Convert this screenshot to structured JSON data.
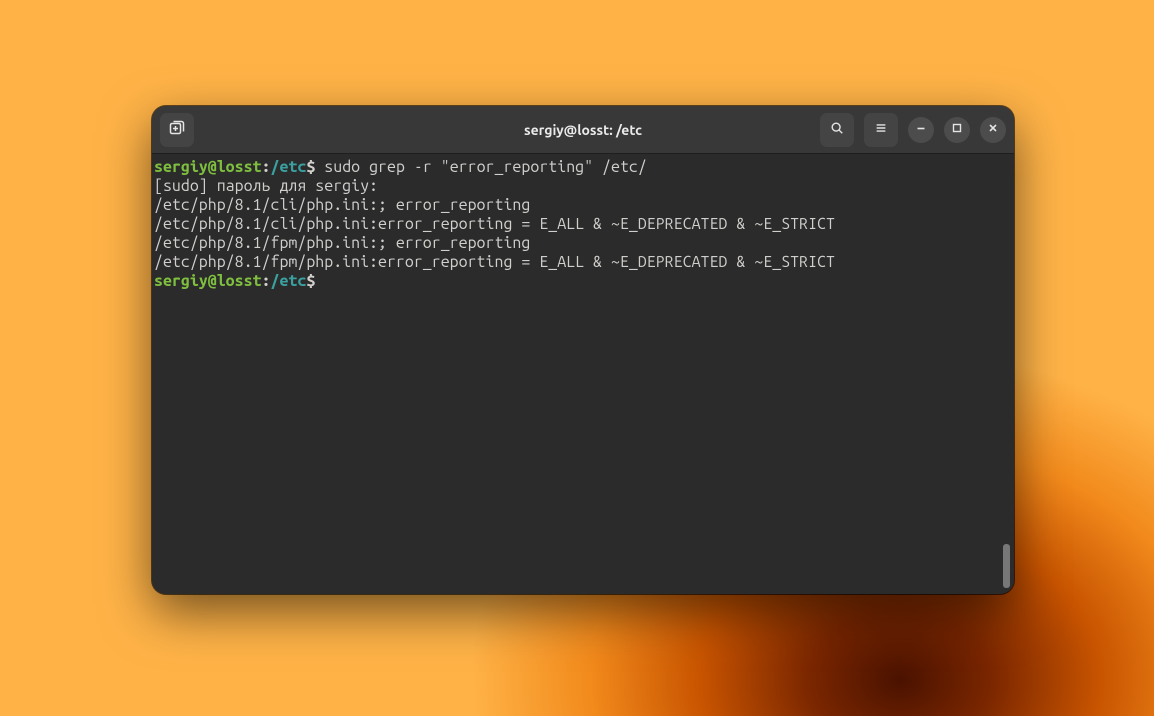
{
  "window": {
    "title": "sergiy@losst: /etc"
  },
  "prompt": {
    "user_host": "sergiy@losst",
    "separator": ":",
    "path": "/etc",
    "sigil": "$"
  },
  "icons": {
    "new_tab": "new-tab-icon",
    "search": "search-icon",
    "menu": "menu-icon",
    "minimize": "minimize-icon",
    "maximize": "maximize-icon",
    "close": "close-icon"
  },
  "lines": {
    "cmd1": " sudo grep -r \"error_reporting\" /etc/",
    "l2": "[sudo] пароль для sergiy:",
    "l3": "/etc/php/8.1/cli/php.ini:; error_reporting",
    "l4": "/etc/php/8.1/cli/php.ini:error_reporting = E_ALL & ~E_DEPRECATED & ~E_STRICT",
    "l5": "/etc/php/8.1/fpm/php.ini:; error_reporting",
    "l6": "/etc/php/8.1/fpm/php.ini:error_reporting = E_ALL & ~E_DEPRECATED & ~E_STRICT",
    "cmd2": " "
  }
}
